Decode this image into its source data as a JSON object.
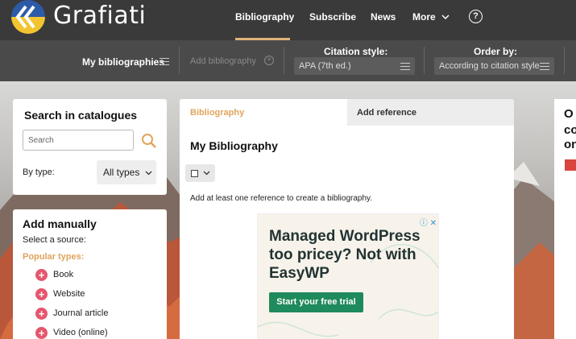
{
  "brand": {
    "name": "Grafiati"
  },
  "nav": {
    "items": [
      "Bibliography",
      "Subscribe",
      "News",
      "More"
    ],
    "help_glyph": "?"
  },
  "toolbar": {
    "my_bibliographies": "My bibliographies",
    "add_bibliography": "Add bibliography",
    "citation_style_label": "Citation style:",
    "citation_style_value": "APA (7th ed.)",
    "order_by_label": "Order by:",
    "order_by_value": "According to citation style"
  },
  "search": {
    "title": "Search in catalogues",
    "placeholder": "Search",
    "by_type_label": "By type:",
    "type_value": "All types"
  },
  "add_manually": {
    "title": "Add manually",
    "subtitle": "Select a source:",
    "popular_label": "Popular types:",
    "types": [
      "Book",
      "Website",
      "Journal article",
      "Video (online)"
    ]
  },
  "bibliography": {
    "tabs": [
      "Bibliography",
      "Add reference"
    ],
    "title": "My Bibliography",
    "empty_text": "Add at least one reference to create a bibliography."
  },
  "ad": {
    "headline": "Managed WordPress too pricey? Not with EasyWP",
    "cta": "Start your free trial"
  },
  "right_strip": {
    "lines": [
      "O",
      "co",
      "on"
    ]
  },
  "colors": {
    "accent": "#e0a45c",
    "plus": "#e5566c",
    "topbar": "#3a3a3a",
    "ad_cta": "#1f8a5b"
  }
}
